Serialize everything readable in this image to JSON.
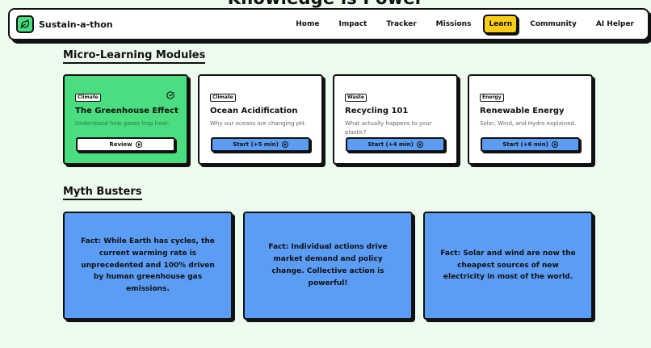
{
  "hero": {
    "title": "Knowledge is Power"
  },
  "nav": {
    "brand": "Sustain-a-thon",
    "links": [
      "Home",
      "Impact",
      "Tracker",
      "Missions",
      "Learn",
      "Community",
      "AI Helper"
    ],
    "active": "Learn"
  },
  "modules_section": {
    "title": "Micro-Learning Modules"
  },
  "modules": [
    {
      "tag": "Climate",
      "title": "The Greenhouse Effect",
      "desc": "Understand how gases trap heat.",
      "button": "Review",
      "completed": true
    },
    {
      "tag": "Climate",
      "title": "Ocean Acidification",
      "desc": "Why our oceans are changing pH.",
      "button": "Start (+5 min)",
      "completed": false
    },
    {
      "tag": "Waste",
      "title": "Recycling 101",
      "desc": "What actually happens to your plastic?",
      "button": "Start (+4 min)",
      "completed": false
    },
    {
      "tag": "Energy",
      "title": "Renewable Energy",
      "desc": "Solar, Wind, and Hydro explained.",
      "button": "Start (+6 min)",
      "completed": false
    }
  ],
  "myths_section": {
    "title": "Myth Busters"
  },
  "myths": [
    {
      "text": "Fact: While Earth has cycles, the current warming rate is unprecedented and 100% driven by human greenhouse gas emissions."
    },
    {
      "text": "Fact: Individual actions drive market demand and policy change. Collective action is powerful!"
    },
    {
      "text": "Fact: Solar and wind are now the cheapest sources of new electricity in most of the world."
    }
  ],
  "colors": {
    "background": "#edfbef",
    "green": "#4ade80",
    "blue": "#5b9cf5",
    "yellow": "#facc15",
    "ink": "#111111"
  },
  "icons": {
    "logo": "leaf-icon",
    "completed": "check-circle-icon",
    "button": "play-circle-icon"
  }
}
